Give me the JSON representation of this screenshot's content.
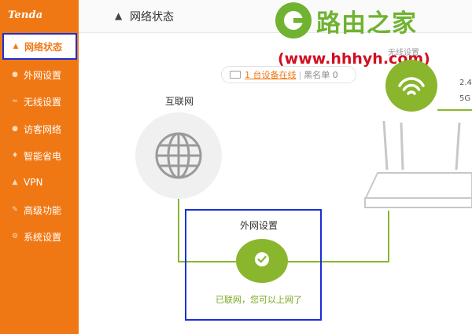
{
  "brand": {
    "logo_text": "Tenda",
    "accent": "#f07814",
    "green": "#8ab62e"
  },
  "sidebar": {
    "items": [
      {
        "label": "网络状态",
        "icon": "status-icon",
        "active": true
      },
      {
        "label": "外网设置",
        "icon": "globe-icon"
      },
      {
        "label": "无线设置",
        "icon": "wifi-icon"
      },
      {
        "label": "访客网络",
        "icon": "guest-icon"
      },
      {
        "label": "智能省电",
        "icon": "power-icon"
      },
      {
        "label": "VPN",
        "icon": "vpn-icon"
      },
      {
        "label": "高级功能",
        "icon": "tools-icon"
      },
      {
        "label": "系统设置",
        "icon": "settings-icon"
      }
    ]
  },
  "header": {
    "title": "网络状态",
    "icon": "router-small-icon"
  },
  "watermark": {
    "title": "路由之家",
    "url": "(www.hhhyh.com)"
  },
  "devices": {
    "online": "1 台设备在线",
    "separator": "|",
    "blacklist": "黑名单 0"
  },
  "internet": {
    "label": "互联网"
  },
  "wan": {
    "label": "外网设置",
    "status": "已联网，您可以上网了"
  },
  "wireless": {
    "label": "无线设置",
    "band_24": "2.4",
    "band_5": "5G"
  }
}
